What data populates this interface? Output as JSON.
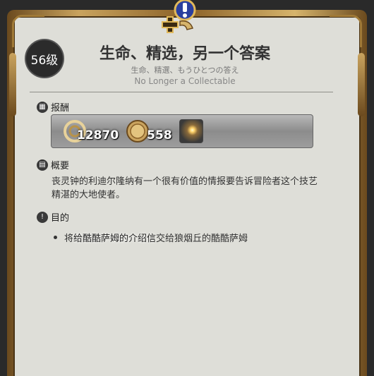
{
  "level": "56级",
  "title": "生命、精选，另一个答案",
  "subtitle_jp": "生命、精選、もうひとつの答え",
  "subtitle_en": "No Longer a Collectable",
  "sections": {
    "rewards_label": "报酬",
    "summary_label": "概要",
    "objective_label": "目的"
  },
  "rewards": {
    "exp": "12870",
    "gil": "558"
  },
  "summary": "丧灵钟的利迪尔隆纳有一个很有价值的情报要告诉冒险者这个技艺精湛的大地使者。",
  "objective": {
    "prefix": "将",
    "highlight": "给酷酷萨姆的介绍信",
    "suffix": "交给狼烟丘的酷酷萨姆"
  },
  "colors": {
    "panel_bg": "#deded8",
    "gold_frame": "#c9a35e",
    "badge_bg": "#2b2b2b"
  },
  "icons": {
    "quest": "quest-marker-icon",
    "rewards": "rewards-icon",
    "summary": "book-icon",
    "objective": "exclamation-icon"
  }
}
